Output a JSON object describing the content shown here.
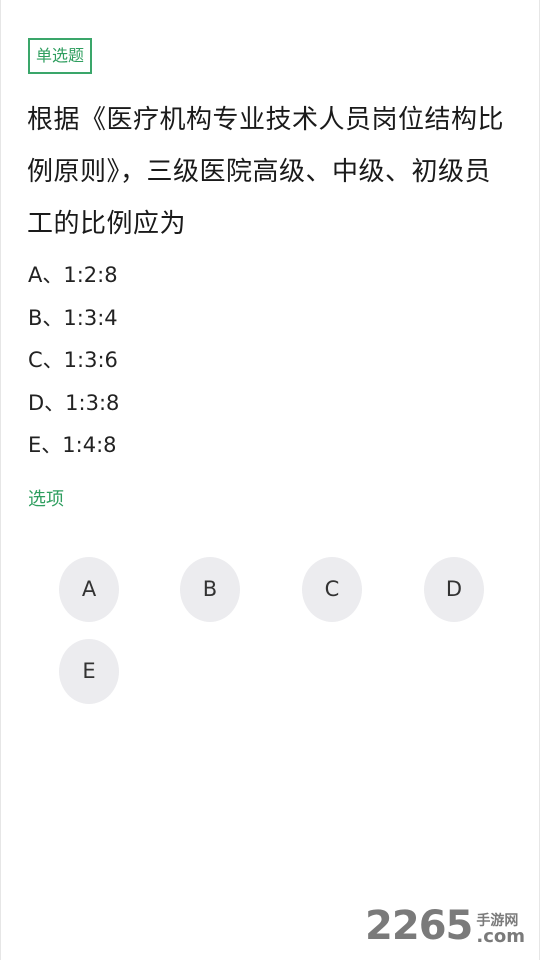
{
  "question": {
    "type_label": "单选题",
    "text": "根据《医疗机构专业技术人员岗位结构比例原则》，三级医院高级、中级、初级员工的比例应为",
    "options": [
      {
        "letter": "A",
        "text": "A、1:2:8"
      },
      {
        "letter": "B",
        "text": "B、1:3:4"
      },
      {
        "letter": "C",
        "text": "C、1:3:6"
      },
      {
        "letter": "D",
        "text": "D、1:3:8"
      },
      {
        "letter": "E",
        "text": "E、1:4:8"
      }
    ]
  },
  "answer_section": {
    "label": "选项",
    "buttons": [
      "A",
      "B",
      "C",
      "D",
      "E"
    ]
  },
  "watermark": {
    "main": "2265",
    "chinese": "手游网",
    "suffix": ".com"
  },
  "colors": {
    "accent": "#2f9e5f",
    "button_bg": "#ececef",
    "text": "#1a1a1a"
  }
}
